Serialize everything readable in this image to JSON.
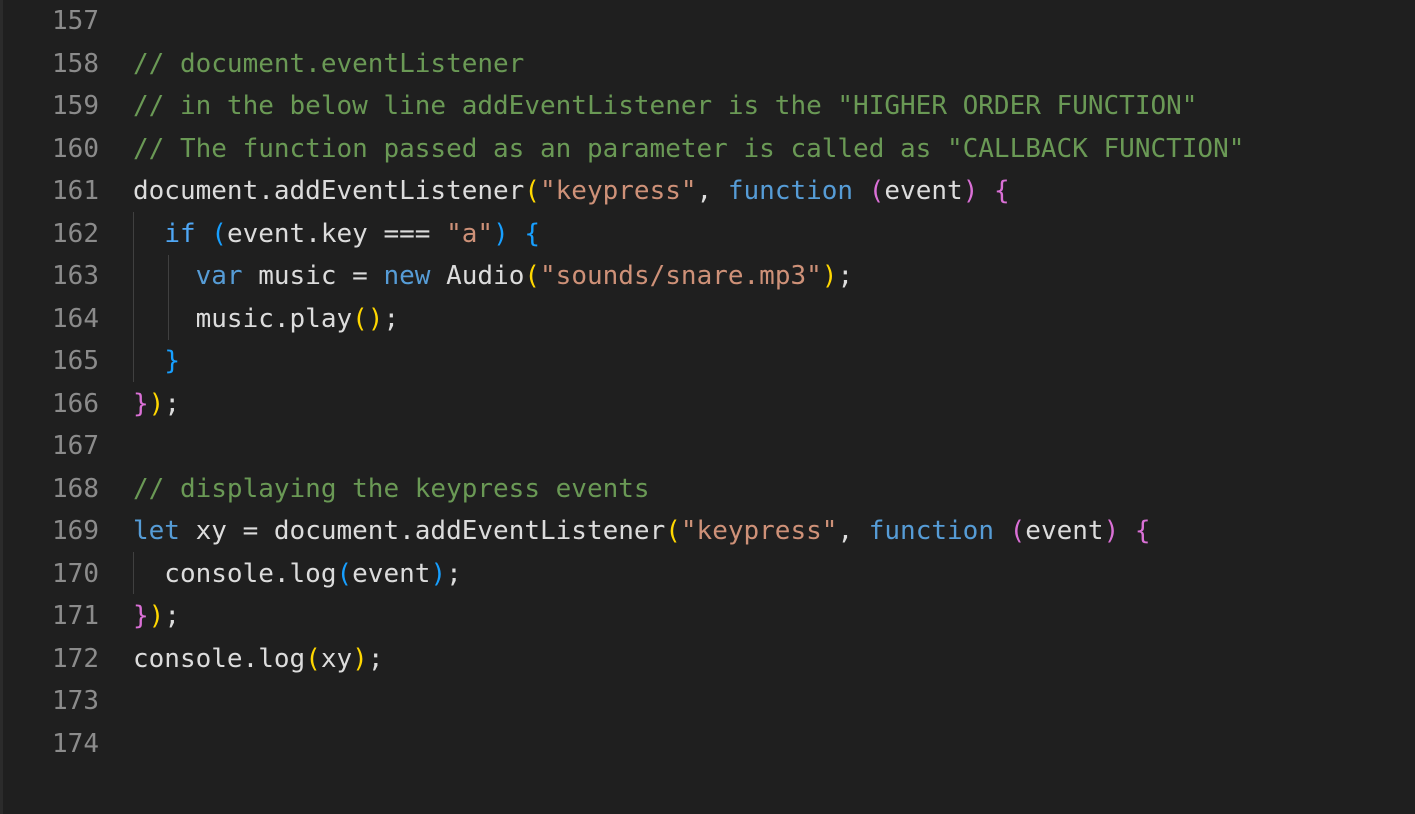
{
  "editor": {
    "lines": [
      {
        "num": "157",
        "tokens": []
      },
      {
        "num": "158",
        "tokens": [
          {
            "t": "// document.eventListener",
            "c": "c"
          }
        ]
      },
      {
        "num": "159",
        "tokens": [
          {
            "t": "// in the below line addEventListener is the \"HIGHER ORDER FUNCTION\"",
            "c": "c"
          }
        ]
      },
      {
        "num": "160",
        "tokens": [
          {
            "t": "// The function passed as an parameter is called as \"CALLBACK FUNCTION\"",
            "c": "c"
          }
        ]
      },
      {
        "num": "161",
        "tokens": [
          {
            "t": "document.addEventListener",
            "c": "t"
          },
          {
            "t": "(",
            "c": "b1"
          },
          {
            "t": "\"keypress\"",
            "c": "s"
          },
          {
            "t": ", ",
            "c": "t"
          },
          {
            "t": "function",
            "c": "k"
          },
          {
            "t": " ",
            "c": "t"
          },
          {
            "t": "(",
            "c": "b2"
          },
          {
            "t": "event",
            "c": "t"
          },
          {
            "t": ")",
            "c": "b2"
          },
          {
            "t": " ",
            "c": "t"
          },
          {
            "t": "{",
            "c": "b2"
          }
        ]
      },
      {
        "num": "162",
        "tokens": [
          {
            "t": "  ",
            "c": "t"
          },
          {
            "t": "if",
            "c": "ck"
          },
          {
            "t": " ",
            "c": "t"
          },
          {
            "t": "(",
            "c": "b3"
          },
          {
            "t": "event.key === ",
            "c": "t"
          },
          {
            "t": "\"a\"",
            "c": "s"
          },
          {
            "t": ")",
            "c": "b3"
          },
          {
            "t": " ",
            "c": "t"
          },
          {
            "t": "{",
            "c": "b3"
          }
        ]
      },
      {
        "num": "163",
        "tokens": [
          {
            "t": "    ",
            "c": "t"
          },
          {
            "t": "var",
            "c": "k"
          },
          {
            "t": " music = ",
            "c": "t"
          },
          {
            "t": "new",
            "c": "k"
          },
          {
            "t": " Audio",
            "c": "t"
          },
          {
            "t": "(",
            "c": "b1"
          },
          {
            "t": "\"sounds/snare.mp3\"",
            "c": "s"
          },
          {
            "t": ")",
            "c": "b1"
          },
          {
            "t": ";",
            "c": "t"
          }
        ]
      },
      {
        "num": "164",
        "tokens": [
          {
            "t": "    music.play",
            "c": "t"
          },
          {
            "t": "()",
            "c": "b1"
          },
          {
            "t": ";",
            "c": "t"
          }
        ]
      },
      {
        "num": "165",
        "tokens": [
          {
            "t": "  ",
            "c": "t"
          },
          {
            "t": "}",
            "c": "b3"
          }
        ]
      },
      {
        "num": "166",
        "tokens": [
          {
            "t": "}",
            "c": "b2"
          },
          {
            "t": ")",
            "c": "b1"
          },
          {
            "t": ";",
            "c": "t"
          }
        ]
      },
      {
        "num": "167",
        "tokens": []
      },
      {
        "num": "168",
        "tokens": [
          {
            "t": "// displaying the keypress events",
            "c": "c"
          }
        ]
      },
      {
        "num": "169",
        "tokens": [
          {
            "t": "let",
            "c": "k"
          },
          {
            "t": " xy = document.addEventListener",
            "c": "t"
          },
          {
            "t": "(",
            "c": "b1"
          },
          {
            "t": "\"keypress\"",
            "c": "s"
          },
          {
            "t": ", ",
            "c": "t"
          },
          {
            "t": "function",
            "c": "k"
          },
          {
            "t": " ",
            "c": "t"
          },
          {
            "t": "(",
            "c": "b2"
          },
          {
            "t": "event",
            "c": "t"
          },
          {
            "t": ")",
            "c": "b2"
          },
          {
            "t": " ",
            "c": "t"
          },
          {
            "t": "{",
            "c": "b2"
          }
        ]
      },
      {
        "num": "170",
        "tokens": [
          {
            "t": "  console.log",
            "c": "t"
          },
          {
            "t": "(",
            "c": "b3"
          },
          {
            "t": "event",
            "c": "t"
          },
          {
            "t": ")",
            "c": "b3"
          },
          {
            "t": ";",
            "c": "t"
          }
        ]
      },
      {
        "num": "171",
        "tokens": [
          {
            "t": "}",
            "c": "b2"
          },
          {
            "t": ")",
            "c": "b1"
          },
          {
            "t": ";",
            "c": "t"
          }
        ]
      },
      {
        "num": "172",
        "tokens": [
          {
            "t": "console.log",
            "c": "t"
          },
          {
            "t": "(",
            "c": "b1"
          },
          {
            "t": "xy",
            "c": "t"
          },
          {
            "t": ")",
            "c": "b1"
          },
          {
            "t": ";",
            "c": "t"
          }
        ]
      },
      {
        "num": "173",
        "tokens": []
      },
      {
        "num": "174",
        "tokens": []
      }
    ]
  }
}
